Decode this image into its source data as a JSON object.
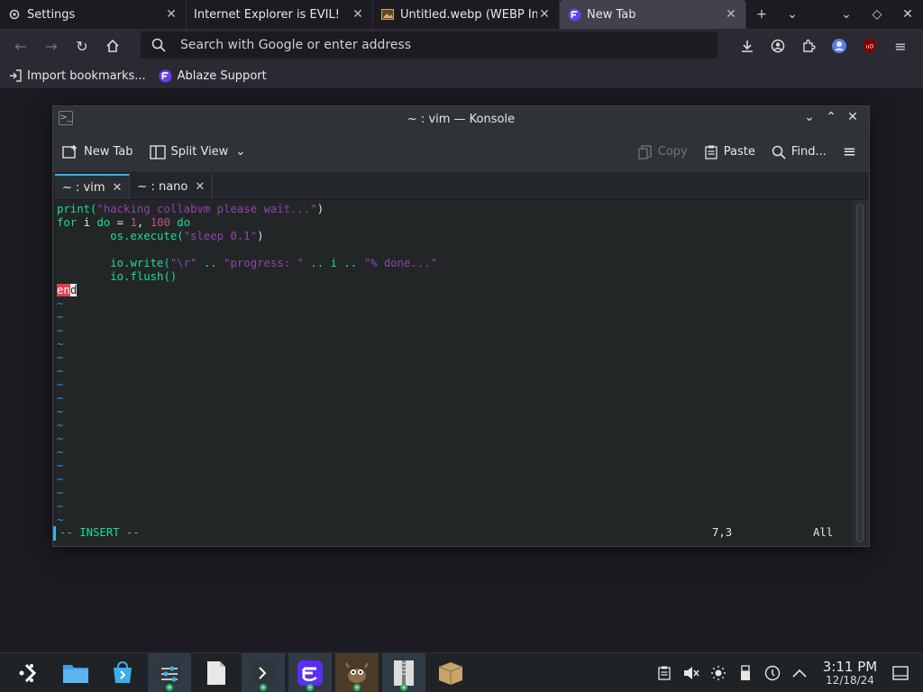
{
  "browser": {
    "tabs": [
      {
        "label": "Settings",
        "icon": "gear-icon"
      },
      {
        "label": "Internet Explorer is EVIL!",
        "icon": ""
      },
      {
        "label": "Untitled.webp (WEBP Im",
        "icon": "image-icon"
      },
      {
        "label": "New Tab",
        "icon": "ablaze-logo-icon"
      }
    ],
    "address_placeholder": "Search with Google or enter address",
    "bookmarks": [
      {
        "label": "Import bookmarks...",
        "icon": "import-icon"
      },
      {
        "label": "Ablaze Support",
        "icon": "ablaze-logo-icon"
      }
    ]
  },
  "konsole": {
    "title": "~ : vim — Konsole",
    "toolbar": {
      "new_tab": "New Tab",
      "split_view": "Split View",
      "copy": "Copy",
      "paste": "Paste",
      "find": "Find..."
    },
    "tabs": [
      {
        "label": "~ : vim"
      },
      {
        "label": "~ : nano"
      }
    ],
    "editor": {
      "mode": "-- INSERT --",
      "position": "7,3",
      "scroll": "All",
      "code": {
        "l1_fn": "print(",
        "l1_str": "\"hacking collabvm please wait...\"",
        "l1_end": ")",
        "l2_kw1": "for",
        "l2_mid": " i ",
        "l2_kw2": "do",
        "l2_eq": " = ",
        "l2_n1": "1",
        "l2_comma": ", ",
        "l2_n2": "100",
        "l2_kw3": " do",
        "l3_fn": "os.execute(",
        "l3_str": "\"sleep 0.1\"",
        "l3_end": ")",
        "l5_fn": "io.write(",
        "l5_s1": "\"\\r\"",
        "l5_op1": " .. ",
        "l5_s2": "\"progress: \"",
        "l5_op2": " .. i .. ",
        "l5_s3": "\"% done...\"",
        "l6_fn": "io.flush()",
        "l7_a": "en",
        "l7_b": "d"
      },
      "tilde": "~"
    }
  },
  "taskbar": {
    "apps": [
      {
        "name": "kickoff-launcher",
        "open": false
      },
      {
        "name": "dolphin-file-manager",
        "open": false
      },
      {
        "name": "discover-store",
        "open": false
      },
      {
        "name": "system-settings",
        "open": true
      },
      {
        "name": "text-file",
        "open": false
      },
      {
        "name": "konsole-terminal",
        "open": true
      },
      {
        "name": "ablaze-floorp",
        "open": true
      },
      {
        "name": "gimp",
        "open": true
      },
      {
        "name": "archive-manager",
        "open": true
      },
      {
        "name": "package-installer",
        "open": false
      }
    ],
    "time": "3:11 PM",
    "date": "12/18/24"
  },
  "colors": {
    "accent": "#3daee9",
    "vim_green": "#1cdc9a",
    "vim_string": "#8e44ad",
    "vim_number": "#c04f8e",
    "cursor": "#da4453"
  }
}
